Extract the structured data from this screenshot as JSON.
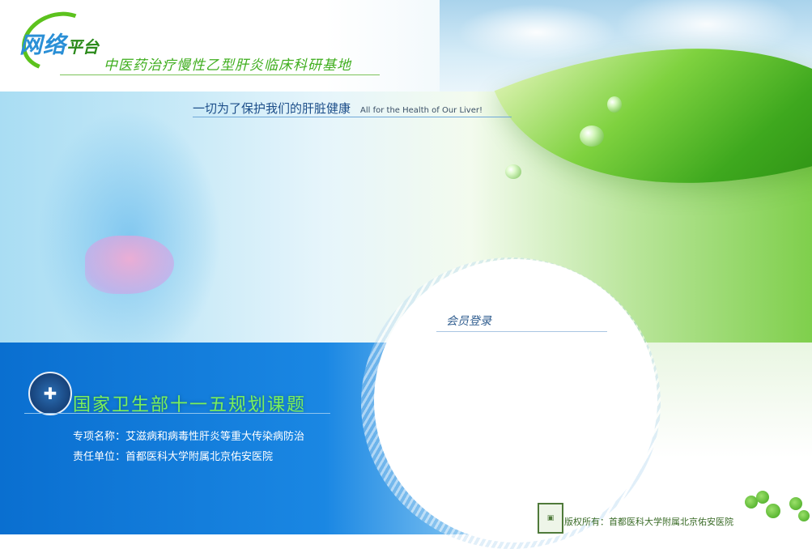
{
  "header": {
    "brand_big": "网络",
    "brand_small": "平台",
    "subtitle": "中医药治疗慢性乙型肝炎临床科研基地"
  },
  "banner": {
    "slogan_cn": "一切为了保护我们的肝脏健康",
    "slogan_en": "All for the Health of Our Liver!"
  },
  "login": {
    "title": "会员登录"
  },
  "project": {
    "title": "国家卫生部十一五规划课题",
    "line1": "专项名称：艾滋病和病毒性肝炎等重大传染病防治",
    "line2": "责任单位：首都医科大学附属北京佑安医院"
  },
  "footer": {
    "copyright": "版权所有：首都医科大学附属北京佑安医院"
  },
  "colors": {
    "brand_blue": "#2a8fd6",
    "brand_green": "#3fae1e",
    "panel_blue": "#0a6fd0",
    "title_green": "#7cf05a"
  }
}
